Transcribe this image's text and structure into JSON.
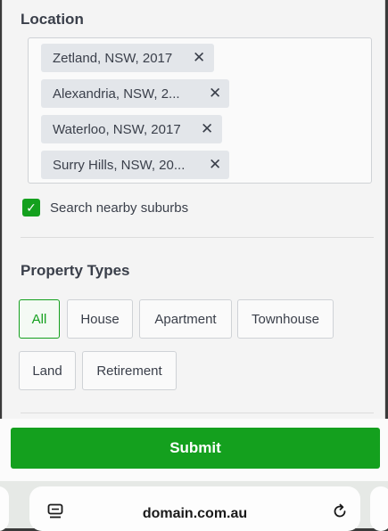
{
  "location": {
    "title": "Location",
    "chips": [
      {
        "label": "Zetland, NSW, 2017"
      },
      {
        "label": "Alexandria, NSW, 2..."
      },
      {
        "label": "Waterloo, NSW, 2017"
      },
      {
        "label": "Surry Hills, NSW, 20..."
      }
    ],
    "remove_glyph": "✕"
  },
  "nearby": {
    "label": "Search nearby suburbs",
    "checked": true,
    "check_glyph": "✓"
  },
  "property_types": {
    "title": "Property Types",
    "options": [
      {
        "label": "All",
        "selected": true
      },
      {
        "label": "House",
        "selected": false
      },
      {
        "label": "Apartment",
        "selected": false
      },
      {
        "label": "Townhouse",
        "selected": false
      },
      {
        "label": "Land",
        "selected": false
      },
      {
        "label": "Retirement",
        "selected": false
      }
    ]
  },
  "submit": {
    "label": "Submit"
  },
  "browser": {
    "url": "domain.com.au",
    "tabs_icon": "tabs-icon",
    "reload_icon": "reload-icon"
  },
  "colors": {
    "accent": "#14a01e",
    "text": "#3a3f4a",
    "chip_bg": "#e3e6ea"
  }
}
